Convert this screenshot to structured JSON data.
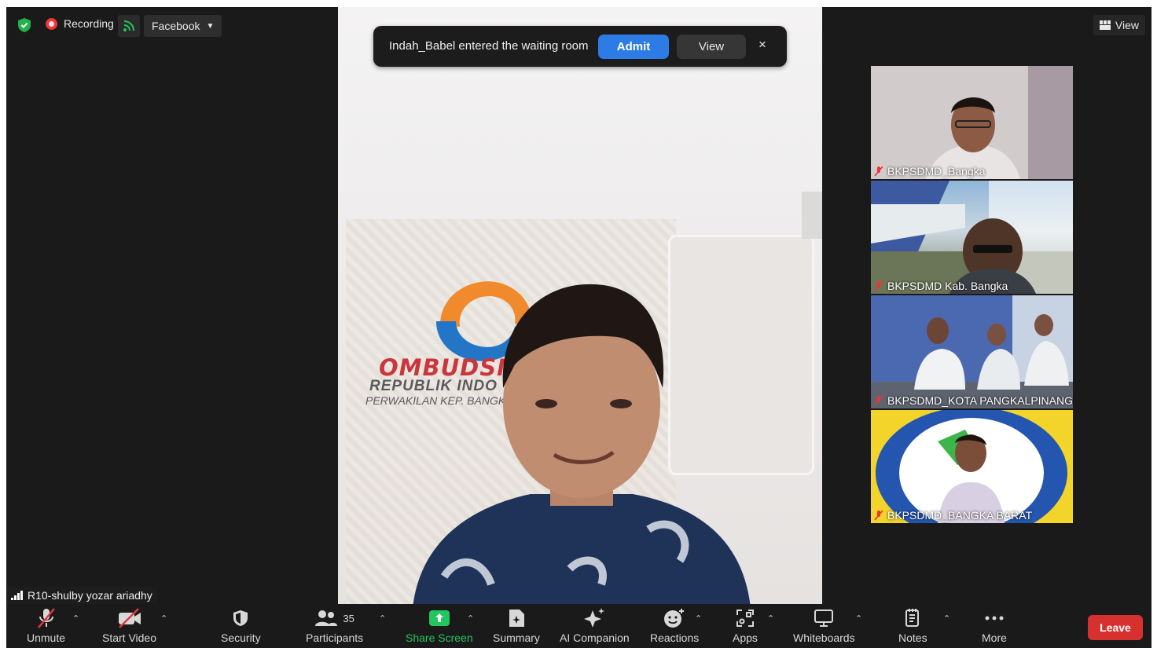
{
  "topbar": {
    "recording_label": "Recording",
    "stream_target": "Facebook",
    "view_label": "View"
  },
  "notification": {
    "text": "Indah_Babel entered the waiting room",
    "admit_label": "Admit",
    "view_label": "View",
    "close_glyph": "×"
  },
  "main_video": {
    "wall_text_1": "OMBUDSN",
    "wall_text_2": "REPUBLIK INDO",
    "wall_text_3": "PERWAKILAN KEP. BANGKA"
  },
  "participants_thumbs": [
    {
      "name": "BKPSDMD_Bangka",
      "muted": true
    },
    {
      "name": "BKPSDMD Kab. Bangka",
      "muted": true
    },
    {
      "name": "BKPSDMD_KOTA PANGKALPINANG",
      "muted": true
    },
    {
      "name": "BKPSDMD_BANGKA BARAT",
      "muted": true
    }
  ],
  "active_speaker": {
    "name": "R10-shulby yozar ariadhy"
  },
  "toolbar": {
    "unmute": "Unmute",
    "start_video": "Start Video",
    "security": "Security",
    "participants": "Participants",
    "participants_count": "35",
    "share_screen": "Share Screen",
    "summary": "Summary",
    "ai_companion": "AI Companion",
    "reactions": "Reactions",
    "apps": "Apps",
    "whiteboards": "Whiteboards",
    "notes": "Notes",
    "more": "More",
    "leave": "Leave"
  },
  "colors": {
    "admit_blue": "#2d7ce6",
    "leave_red": "#d7312f",
    "share_green": "#22c55e",
    "recording_red": "#e8383d"
  }
}
